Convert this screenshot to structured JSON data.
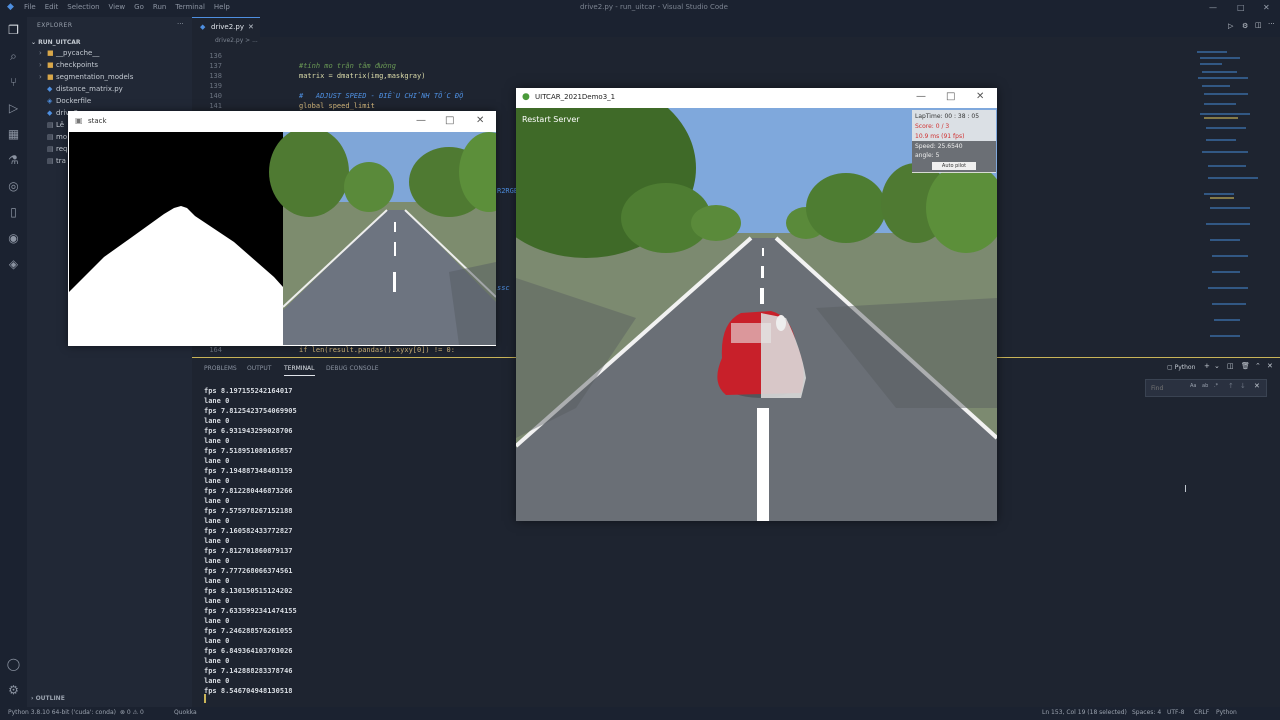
{
  "titlebar": {
    "menu": [
      "File",
      "Edit",
      "Selection",
      "View",
      "Go",
      "Run",
      "Terminal",
      "Help"
    ],
    "window_title": "drive2.py - run_uitcar - Visual Studio Code"
  },
  "sidebar": {
    "header": "EXPLORER",
    "project": "RUN_UITCAR",
    "items": [
      {
        "label": "__pycache__",
        "type": "folder"
      },
      {
        "label": "checkpoints",
        "type": "folder"
      },
      {
        "label": "segmentation_models",
        "type": "folder"
      },
      {
        "label": "distance_matrix.py",
        "type": "file"
      },
      {
        "label": "Dockerfile",
        "type": "file"
      },
      {
        "label": "drive2.py",
        "type": "file"
      },
      {
        "label": "Lê",
        "type": "file"
      },
      {
        "label": "mo",
        "type": "file"
      },
      {
        "label": "req",
        "type": "file"
      },
      {
        "label": "tra",
        "type": "file"
      }
    ],
    "outline": "OUTLINE"
  },
  "editor": {
    "tab": "drive2.py",
    "breadcrumb": "drive2.py > ...",
    "lines": [
      {
        "n": "136",
        "code": ""
      },
      {
        "n": "137",
        "code": "#tính mo trận tâm đường"
      },
      {
        "n": "138",
        "code": "matrix = dmatrix(img,maskgray)"
      },
      {
        "n": "139",
        "code": ""
      },
      {
        "n": "140",
        "code": "#   ADJUST SPEED - ĐIỀU CHỈNH TỐC ĐỘ"
      },
      {
        "n": "141",
        "code": "global speed_limit"
      },
      {
        "n": "164",
        "code": "if len(result.pandas().xyxy[0]) != 0:"
      }
    ],
    "peek_text_1": "R2RGB",
    "peek_text_2": "ssc"
  },
  "panel": {
    "tabs": [
      "PROBLEMS",
      "OUTPUT",
      "TERMINAL",
      "DEBUG CONSOLE"
    ],
    "active_tab": "TERMINAL",
    "shell": "Python",
    "find_placeholder": "Find",
    "terminal_lines": [
      "fps 8.197155242164017",
      "lane 0",
      "fps 7.8125423754069905",
      "lane 0",
      "fps 6.931943299028706",
      "lane 0",
      "fps 7.518951080165857",
      "lane 0",
      "fps 7.194887348483159",
      "lane 0",
      "fps 7.812280446873266",
      "lane 0",
      "fps 7.575978267152188",
      "lane 0",
      "fps 7.160582433772827",
      "lane 0",
      "fps 7.812701860879137",
      "lane 0",
      "fps 7.777268066374561",
      "lane 0",
      "fps 8.130150515124202",
      "lane 0",
      "fps 7.6335992341474155",
      "lane 0",
      "fps 7.246288576261055",
      "lane 0",
      "fps 6.849364103703026",
      "lane 0",
      "fps 7.142888283378746",
      "lane 0",
      "fps 8.546704948130518"
    ]
  },
  "status": {
    "python": "Python 3.8.10 64-bit ('cuda': conda)",
    "problems": "⊗ 0 ⚠ 0",
    "quokka": "Quokka",
    "position": "Ln 153, Col 19 (18 selected)",
    "spaces": "Spaces: 4",
    "encoding": "UTF-8",
    "eol": "CRLF",
    "language": "Python"
  },
  "stack_window": {
    "title": "stack"
  },
  "game_window": {
    "title": "UITCAR_2021Demo3_1",
    "restart_button": "Restart Server",
    "hud": {
      "laptime": "LapTime:  00 : 38 : 05",
      "score": "Score: 0 / 3",
      "ms": "10.9 ms (91 fps)",
      "speed": "Speed: 25.6540",
      "angle": "angle: 5",
      "autopilot": "Auto pilot"
    }
  },
  "colors": {
    "accent": "#4e8fe0",
    "hud_red": "#d03030",
    "car_red": "#c8202a"
  }
}
